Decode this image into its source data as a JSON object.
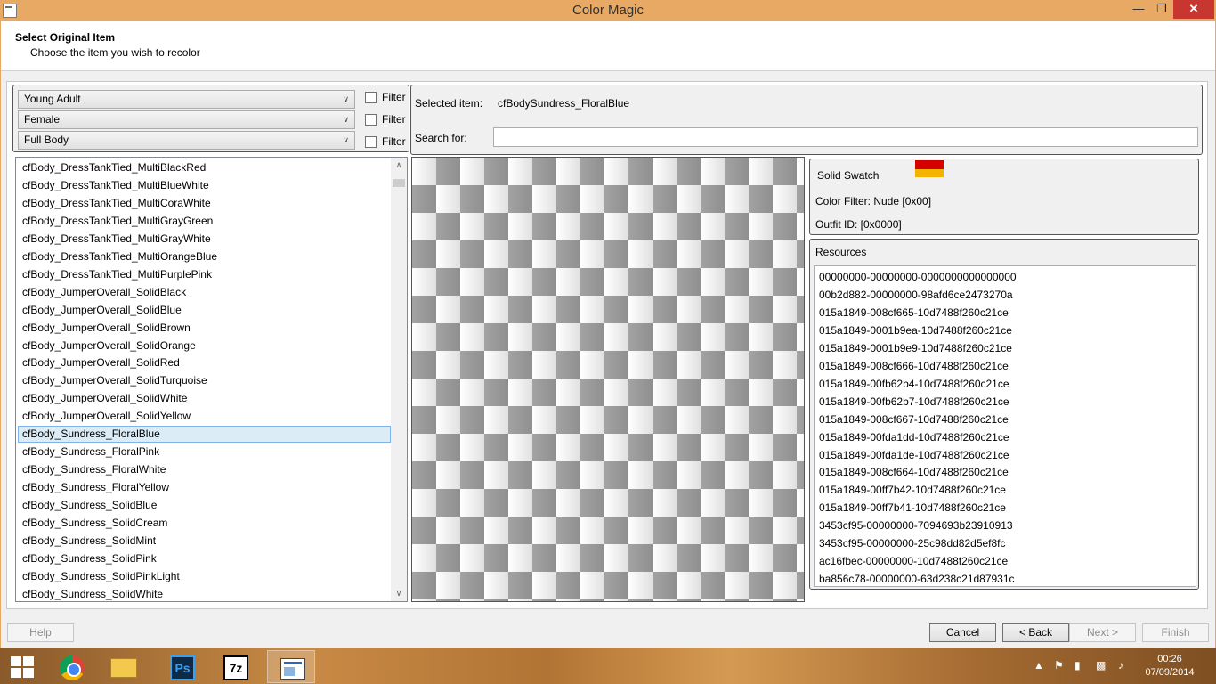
{
  "window": {
    "title": "Color Magic"
  },
  "header": {
    "title": "Select Original Item",
    "subtitle": "Choose the item you wish to recolor"
  },
  "filters": {
    "age": "Young Adult",
    "gender": "Female",
    "category": "Full Body",
    "filter_label": "Filter"
  },
  "selected": {
    "label": "Selected item:",
    "value": "cfBodySundress_FloralBlue",
    "search_label": "Search for:",
    "search_value": ""
  },
  "items": [
    "cfBody_DressTankTied_MultiBlackRed",
    "cfBody_DressTankTied_MultiBlueWhite",
    "cfBody_DressTankTied_MultiCoraWhite",
    "cfBody_DressTankTied_MultiGrayGreen",
    "cfBody_DressTankTied_MultiGrayWhite",
    "cfBody_DressTankTied_MultiOrangeBlue",
    "cfBody_DressTankTied_MultiPurplePink",
    "cfBody_JumperOverall_SolidBlack",
    "cfBody_JumperOverall_SolidBlue",
    "cfBody_JumperOverall_SolidBrown",
    "cfBody_JumperOverall_SolidOrange",
    "cfBody_JumperOverall_SolidRed",
    "cfBody_JumperOverall_SolidTurquoise",
    "cfBody_JumperOverall_SolidWhite",
    "cfBody_JumperOverall_SolidYellow",
    "cfBody_Sundress_FloralBlue",
    "cfBody_Sundress_FloralPink",
    "cfBody_Sundress_FloralWhite",
    "cfBody_Sundress_FloralYellow",
    "cfBody_Sundress_SolidBlue",
    "cfBody_Sundress_SolidCream",
    "cfBody_Sundress_SolidMint",
    "cfBody_Sundress_SolidPink",
    "cfBody_Sundress_SolidPinkLight",
    "cfBody_Sundress_SolidWhite"
  ],
  "selected_index": 15,
  "swatch": {
    "name": "Solid Swatch",
    "color_filter": "Color Filter: Nude [0x00]",
    "outfit_id": "Outfit ID: [0x0000]",
    "colors": [
      "#d40000",
      "#f3b300"
    ]
  },
  "resources": {
    "title": "Resources",
    "items": [
      "00000000-00000000-0000000000000000",
      "00b2d882-00000000-98afd6ce2473270a",
      "015a1849-008cf665-10d7488f260c21ce",
      "015a1849-0001b9ea-10d7488f260c21ce",
      "015a1849-0001b9e9-10d7488f260c21ce",
      "015a1849-008cf666-10d7488f260c21ce",
      "015a1849-00fb62b4-10d7488f260c21ce",
      "015a1849-00fb62b7-10d7488f260c21ce",
      "015a1849-008cf667-10d7488f260c21ce",
      "015a1849-00fda1dd-10d7488f260c21ce",
      "015a1849-00fda1de-10d7488f260c21ce",
      "015a1849-008cf664-10d7488f260c21ce",
      "015a1849-00ff7b42-10d7488f260c21ce",
      "015a1849-00ff7b41-10d7488f260c21ce",
      "3453cf95-00000000-7094693b23910913",
      "3453cf95-00000000-25c98dd82d5ef8fc",
      "ac16fbec-00000000-10d7488f260c21ce",
      "ba856c78-00000000-63d238c21d87931c"
    ]
  },
  "buttons": {
    "help": "Help",
    "cancel": "Cancel",
    "back": "< Back",
    "next": "Next >",
    "finish": "Finish"
  },
  "taskbar": {
    "ps_label": "Ps",
    "sevenzip_label": "7z",
    "time": "00:26",
    "date": "07/09/2014"
  }
}
